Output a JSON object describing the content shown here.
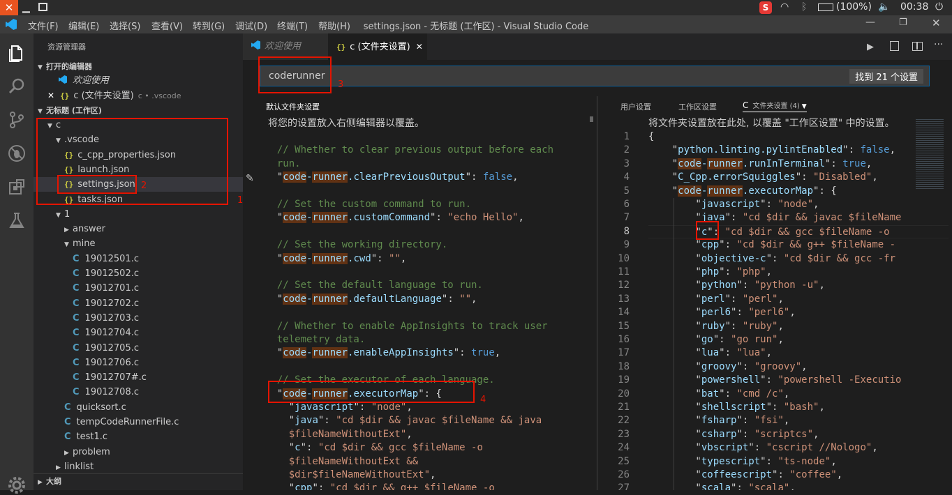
{
  "system": {
    "battery": "(100%)",
    "clock": "00:38"
  },
  "menubar": {
    "items": [
      "文件(F)",
      "编辑(E)",
      "选择(S)",
      "查看(V)",
      "转到(G)",
      "调试(D)",
      "终端(T)",
      "帮助(H)"
    ],
    "title": "settings.json - 无标题 (工作区) - Visual Studio Code"
  },
  "sidebar": {
    "header": "资源管理器",
    "open_editors": "打开的编辑器",
    "open_items": [
      {
        "name": "欢迎使用",
        "detail": ""
      },
      {
        "name": "c (文件夹设置)",
        "detail": "c • .vscode"
      }
    ],
    "workspace": "无标题 (工作区)",
    "tree": [
      {
        "label": "c",
        "indent": 1,
        "kind": "folder-open"
      },
      {
        "label": ".vscode",
        "indent": 2,
        "kind": "folder-open"
      },
      {
        "label": "c_cpp_properties.json",
        "indent": 3,
        "kind": "json"
      },
      {
        "label": "launch.json",
        "indent": 3,
        "kind": "json"
      },
      {
        "label": "settings.json",
        "indent": 3,
        "kind": "json"
      },
      {
        "label": "tasks.json",
        "indent": 3,
        "kind": "json"
      },
      {
        "label": "1",
        "indent": 2,
        "kind": "folder-open"
      },
      {
        "label": "answer",
        "indent": 3,
        "kind": "folder-closed"
      },
      {
        "label": "mine",
        "indent": 3,
        "kind": "folder-open"
      },
      {
        "label": "19012501.c",
        "indent": 4,
        "kind": "c"
      },
      {
        "label": "19012502.c",
        "indent": 4,
        "kind": "c"
      },
      {
        "label": "19012701.c",
        "indent": 4,
        "kind": "c"
      },
      {
        "label": "19012702.c",
        "indent": 4,
        "kind": "c"
      },
      {
        "label": "19012703.c",
        "indent": 4,
        "kind": "c"
      },
      {
        "label": "19012704.c",
        "indent": 4,
        "kind": "c"
      },
      {
        "label": "19012705.c",
        "indent": 4,
        "kind": "c"
      },
      {
        "label": "19012706.c",
        "indent": 4,
        "kind": "c"
      },
      {
        "label": "19012707#.c",
        "indent": 4,
        "kind": "c"
      },
      {
        "label": "19012708.c",
        "indent": 4,
        "kind": "c"
      },
      {
        "label": "quicksort.c",
        "indent": 3,
        "kind": "c"
      },
      {
        "label": "tempCodeRunnerFile.c",
        "indent": 3,
        "kind": "c"
      },
      {
        "label": "test1.c",
        "indent": 3,
        "kind": "c"
      },
      {
        "label": "problem",
        "indent": 3,
        "kind": "folder-closed"
      },
      {
        "label": "linklist",
        "indent": 2,
        "kind": "folder-closed"
      }
    ],
    "outline": "大纲"
  },
  "tabs": [
    {
      "label": "欢迎使用"
    },
    {
      "label": "c (文件夹设置)"
    }
  ],
  "search": {
    "value": "coderunner",
    "result": "找到 21 个设置"
  },
  "left_pane": {
    "title": "默认文件夹设置",
    "hint": "将您的设置放入右侧编辑器以覆盖。",
    "lines": [
      [],
      [
        [
          "c-com",
          "  // Whether to clear previous output before each"
        ]
      ],
      [
        [
          "c-com",
          "  run."
        ]
      ],
      [
        [
          "",
          "  \""
        ],
        [
          "hl c-key",
          "code"
        ],
        [
          "c-key",
          "-"
        ],
        [
          "hl c-key",
          "runner"
        ],
        [
          "c-key",
          ".clearPreviousOutput"
        ],
        [
          "",
          "\": "
        ],
        [
          "c-bool",
          "false"
        ],
        [
          "",
          ","
        ]
      ],
      [],
      [
        [
          "c-com",
          "  // Set the custom command to run."
        ]
      ],
      [
        [
          "",
          "  \""
        ],
        [
          "hl c-key",
          "code"
        ],
        [
          "c-key",
          "-"
        ],
        [
          "hl c-key",
          "runner"
        ],
        [
          "c-key",
          ".customCommand"
        ],
        [
          "",
          "\": "
        ],
        [
          "c-str",
          "\"echo Hello\""
        ],
        [
          "",
          ","
        ]
      ],
      [],
      [
        [
          "c-com",
          "  // Set the working directory."
        ]
      ],
      [
        [
          "",
          "  \""
        ],
        [
          "hl c-key",
          "code"
        ],
        [
          "c-key",
          "-"
        ],
        [
          "hl c-key",
          "runner"
        ],
        [
          "c-key",
          ".cwd"
        ],
        [
          "",
          "\": "
        ],
        [
          "c-str",
          "\"\""
        ],
        [
          "",
          ","
        ]
      ],
      [],
      [
        [
          "c-com",
          "  // Set the default language to run."
        ]
      ],
      [
        [
          "",
          "  \""
        ],
        [
          "hl c-key",
          "code"
        ],
        [
          "c-key",
          "-"
        ],
        [
          "hl c-key",
          "runner"
        ],
        [
          "c-key",
          ".defaultLanguage"
        ],
        [
          "",
          "\": "
        ],
        [
          "c-str",
          "\"\""
        ],
        [
          "",
          ","
        ]
      ],
      [],
      [
        [
          "c-com",
          "  // Whether to enable AppInsights to track user"
        ]
      ],
      [
        [
          "c-com",
          "  telemetry data."
        ]
      ],
      [
        [
          "",
          "  \""
        ],
        [
          "hl c-key",
          "code"
        ],
        [
          "c-key",
          "-"
        ],
        [
          "hl c-key",
          "runner"
        ],
        [
          "c-key",
          ".enableAppInsights"
        ],
        [
          "",
          "\": "
        ],
        [
          "c-bool",
          "true"
        ],
        [
          "",
          ","
        ]
      ],
      [],
      [
        [
          "c-com",
          "  // Set the executor of each language."
        ]
      ],
      [
        [
          "",
          "  \""
        ],
        [
          "hl c-key",
          "code"
        ],
        [
          "c-key",
          "-"
        ],
        [
          "hl c-key",
          "runner"
        ],
        [
          "c-key",
          ".executorMap"
        ],
        [
          "",
          "\": {"
        ]
      ],
      [
        [
          "",
          "    \""
        ],
        [
          "c-key",
          "javascript"
        ],
        [
          "",
          "\": "
        ],
        [
          "c-str",
          "\"node\""
        ],
        [
          "",
          ","
        ]
      ],
      [
        [
          "",
          "    \""
        ],
        [
          "c-key",
          "java"
        ],
        [
          "",
          "\": "
        ],
        [
          "c-str",
          "\"cd $dir && javac $fileName && java"
        ]
      ],
      [
        [
          "c-str",
          "    $fileNameWithoutExt\""
        ],
        [
          "",
          ","
        ]
      ],
      [
        [
          "",
          "    \""
        ],
        [
          "c-key",
          "c"
        ],
        [
          "",
          "\": "
        ],
        [
          "c-str",
          "\"cd $dir && gcc $fileName -o"
        ]
      ],
      [
        [
          "c-str",
          "    $fileNameWithoutExt &&"
        ]
      ],
      [
        [
          "c-str",
          "    $dir$fileNameWithoutExt\""
        ],
        [
          "",
          ","
        ]
      ],
      [
        [
          "",
          "    \""
        ],
        [
          "c-key",
          "cpp"
        ],
        [
          "",
          "\": "
        ],
        [
          "c-str",
          "\"cd $dir && g++ $fileName -o"
        ]
      ]
    ]
  },
  "right_pane": {
    "tabs": [
      "用户设置",
      "工作区设置",
      "C",
      "文件夹设置 (4)"
    ],
    "hint": "将文件夹设置放在此处, 以覆盖 \"工作区设置\" 中的设置。",
    "lines": [
      {
        "n": "1",
        "t": [
          [
            "",
            "{"
          ]
        ]
      },
      {
        "n": "2",
        "t": [
          [
            "",
            "    \""
          ],
          [
            "c-key",
            "python.linting.pylintEnabled"
          ],
          [
            "",
            "\": "
          ],
          [
            "c-bool",
            "false"
          ],
          [
            "",
            ","
          ]
        ]
      },
      {
        "n": "3",
        "t": [
          [
            "",
            "    \""
          ],
          [
            "hl c-key",
            "code"
          ],
          [
            "c-key",
            "-"
          ],
          [
            "hl c-key",
            "runner"
          ],
          [
            "c-key",
            ".runInTerminal"
          ],
          [
            "",
            "\": "
          ],
          [
            "c-bool",
            "true"
          ],
          [
            "",
            ","
          ]
        ]
      },
      {
        "n": "4",
        "t": [
          [
            "",
            "    \""
          ],
          [
            "c-key",
            "C_Cpp.errorSquiggles"
          ],
          [
            "",
            "\": "
          ],
          [
            "c-str",
            "\"Disabled\""
          ],
          [
            "",
            ","
          ]
        ]
      },
      {
        "n": "5",
        "t": [
          [
            "",
            "    \""
          ],
          [
            "hl c-key",
            "code"
          ],
          [
            "c-key",
            "-"
          ],
          [
            "hl c-key",
            "runner"
          ],
          [
            "c-key",
            ".executorMap"
          ],
          [
            "",
            "\": {"
          ]
        ]
      },
      {
        "n": "6",
        "t": [
          [
            "",
            "        \""
          ],
          [
            "c-key",
            "javascript"
          ],
          [
            "",
            "\": "
          ],
          [
            "c-str",
            "\"node\""
          ],
          [
            "",
            ","
          ]
        ]
      },
      {
        "n": "7",
        "t": [
          [
            "",
            "        \""
          ],
          [
            "c-key",
            "java"
          ],
          [
            "",
            "\": "
          ],
          [
            "c-str",
            "\"cd $dir && javac $fileName"
          ]
        ]
      },
      {
        "n": "8",
        "t": [
          [
            "",
            "        \""
          ],
          [
            "c-key",
            "c"
          ],
          [
            "",
            "\": "
          ],
          [
            "c-str",
            "\"cd $dir && gcc $fileName -o"
          ]
        ]
      },
      {
        "n": "9",
        "t": [
          [
            "",
            "        \""
          ],
          [
            "c-key",
            "cpp"
          ],
          [
            "",
            "\": "
          ],
          [
            "c-str",
            "\"cd $dir && g++ $fileName -"
          ]
        ]
      },
      {
        "n": "10",
        "t": [
          [
            "",
            "        \""
          ],
          [
            "c-key",
            "objective-c"
          ],
          [
            "",
            "\": "
          ],
          [
            "c-str",
            "\"cd $dir && gcc -fr"
          ]
        ]
      },
      {
        "n": "11",
        "t": [
          [
            "",
            "        \""
          ],
          [
            "c-key",
            "php"
          ],
          [
            "",
            "\": "
          ],
          [
            "c-str",
            "\"php\""
          ],
          [
            "",
            ","
          ]
        ]
      },
      {
        "n": "12",
        "t": [
          [
            "",
            "        \""
          ],
          [
            "c-key",
            "python"
          ],
          [
            "",
            "\": "
          ],
          [
            "c-str",
            "\"python -u\""
          ],
          [
            "",
            ","
          ]
        ]
      },
      {
        "n": "13",
        "t": [
          [
            "",
            "        \""
          ],
          [
            "c-key",
            "perl"
          ],
          [
            "",
            "\": "
          ],
          [
            "c-str",
            "\"perl\""
          ],
          [
            "",
            ","
          ]
        ]
      },
      {
        "n": "14",
        "t": [
          [
            "",
            "        \""
          ],
          [
            "c-key",
            "perl6"
          ],
          [
            "",
            "\": "
          ],
          [
            "c-str",
            "\"perl6\""
          ],
          [
            "",
            ","
          ]
        ]
      },
      {
        "n": "15",
        "t": [
          [
            "",
            "        \""
          ],
          [
            "c-key",
            "ruby"
          ],
          [
            "",
            "\": "
          ],
          [
            "c-str",
            "\"ruby\""
          ],
          [
            "",
            ","
          ]
        ]
      },
      {
        "n": "16",
        "t": [
          [
            "",
            "        \""
          ],
          [
            "c-key",
            "go"
          ],
          [
            "",
            "\": "
          ],
          [
            "c-str",
            "\"go run\""
          ],
          [
            "",
            ","
          ]
        ]
      },
      {
        "n": "17",
        "t": [
          [
            "",
            "        \""
          ],
          [
            "c-key",
            "lua"
          ],
          [
            "",
            "\": "
          ],
          [
            "c-str",
            "\"lua\""
          ],
          [
            "",
            ","
          ]
        ]
      },
      {
        "n": "18",
        "t": [
          [
            "",
            "        \""
          ],
          [
            "c-key",
            "groovy"
          ],
          [
            "",
            "\": "
          ],
          [
            "c-str",
            "\"groovy\""
          ],
          [
            "",
            ","
          ]
        ]
      },
      {
        "n": "19",
        "t": [
          [
            "",
            "        \""
          ],
          [
            "c-key",
            "powershell"
          ],
          [
            "",
            "\": "
          ],
          [
            "c-str",
            "\"powershell -Executio"
          ]
        ]
      },
      {
        "n": "20",
        "t": [
          [
            "",
            "        \""
          ],
          [
            "c-key",
            "bat"
          ],
          [
            "",
            "\": "
          ],
          [
            "c-str",
            "\"cmd /c\""
          ],
          [
            "",
            ","
          ]
        ]
      },
      {
        "n": "21",
        "t": [
          [
            "",
            "        \""
          ],
          [
            "c-key",
            "shellscript"
          ],
          [
            "",
            "\": "
          ],
          [
            "c-str",
            "\"bash\""
          ],
          [
            "",
            ","
          ]
        ]
      },
      {
        "n": "22",
        "t": [
          [
            "",
            "        \""
          ],
          [
            "c-key",
            "fsharp"
          ],
          [
            "",
            "\": "
          ],
          [
            "c-str",
            "\"fsi\""
          ],
          [
            "",
            ","
          ]
        ]
      },
      {
        "n": "23",
        "t": [
          [
            "",
            "        \""
          ],
          [
            "c-key",
            "csharp"
          ],
          [
            "",
            "\": "
          ],
          [
            "c-str",
            "\"scriptcs\""
          ],
          [
            "",
            ","
          ]
        ]
      },
      {
        "n": "24",
        "t": [
          [
            "",
            "        \""
          ],
          [
            "c-key",
            "vbscript"
          ],
          [
            "",
            "\": "
          ],
          [
            "c-str",
            "\"cscript //Nologo\""
          ],
          [
            "",
            ","
          ]
        ]
      },
      {
        "n": "25",
        "t": [
          [
            "",
            "        \""
          ],
          [
            "c-key",
            "typescript"
          ],
          [
            "",
            "\": "
          ],
          [
            "c-str",
            "\"ts-node\""
          ],
          [
            "",
            ","
          ]
        ]
      },
      {
        "n": "26",
        "t": [
          [
            "",
            "        \""
          ],
          [
            "c-key",
            "coffeescript"
          ],
          [
            "",
            "\": "
          ],
          [
            "c-str",
            "\"coffee\""
          ],
          [
            "",
            ","
          ]
        ]
      },
      {
        "n": "27",
        "t": [
          [
            "",
            "        \""
          ],
          [
            "c-key",
            "scala"
          ],
          [
            "",
            "\": "
          ],
          [
            "c-str",
            "\"scala\""
          ],
          [
            "",
            ","
          ]
        ]
      }
    ]
  },
  "annotations": [
    "1",
    "2",
    "3",
    "4"
  ],
  "colors": {
    "accent": "#007acc",
    "annotation": "#e51400",
    "match_highlight": "#613214"
  }
}
